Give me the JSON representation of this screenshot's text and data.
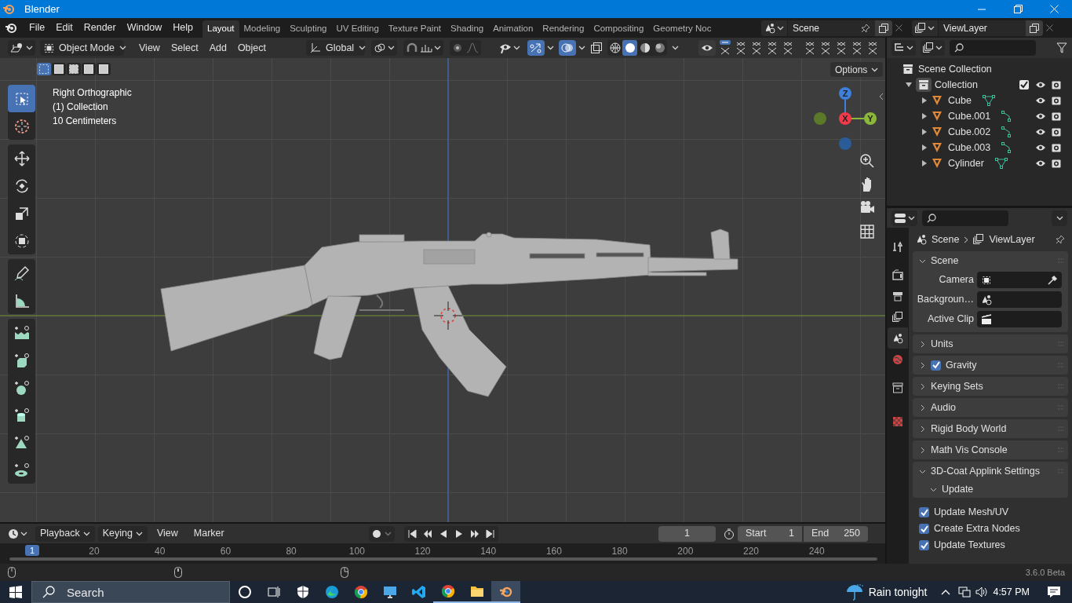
{
  "window": {
    "title": "Blender"
  },
  "menu": [
    "File",
    "Edit",
    "Render",
    "Window",
    "Help"
  ],
  "workspaces": [
    {
      "label": "Layout",
      "selected": true
    },
    {
      "label": "Modeling",
      "selected": false
    },
    {
      "label": "Sculpting",
      "selected": false
    },
    {
      "label": "UV Editing",
      "selected": false
    },
    {
      "label": "Texture Paint",
      "selected": false
    },
    {
      "label": "Shading",
      "selected": false
    },
    {
      "label": "Animation",
      "selected": false
    },
    {
      "label": "Rendering",
      "selected": false
    },
    {
      "label": "Compositing",
      "selected": false
    },
    {
      "label": "Geometry Noc",
      "selected": false
    }
  ],
  "scene_selector": {
    "value": "Scene"
  },
  "view_layer_selector": {
    "value": "ViewLayer"
  },
  "viewport": {
    "mode": "Object Mode",
    "menus": [
      "View",
      "Select",
      "Add",
      "Object"
    ],
    "orientation": "Global",
    "select_modes": [
      {
        "selected": true
      },
      {
        "selected": false
      },
      {
        "selected": false
      },
      {
        "selected": false
      },
      {
        "selected": false
      }
    ],
    "snap_toggle": {
      "on": false
    },
    "proportional_toggle": {
      "on": false
    },
    "gizmo_toggle": {
      "on": true
    },
    "overlay_toggle": {
      "on": true
    },
    "shading": [
      {
        "selected": false
      },
      {
        "selected": true
      },
      {
        "selected": false
      },
      {
        "selected": false
      }
    ],
    "options": "Options",
    "info": [
      "Right Orthographic",
      "(1) Collection",
      "10 Centimeters"
    ],
    "axes": {
      "x": "X",
      "y": "Y",
      "z": "Z"
    },
    "tools": [
      {
        "selected": true
      },
      {
        "selected": false
      },
      {
        "selected": false
      },
      {
        "selected": false
      },
      {
        "selected": false
      },
      {
        "selected": false
      },
      {
        "selected": false
      },
      {
        "selected": false
      },
      {
        "selected": false
      },
      {
        "selected": false
      },
      {
        "selected": false
      },
      {
        "selected": false
      },
      {
        "selected": false
      },
      {
        "selected": false
      }
    ]
  },
  "outliner": {
    "root": "Scene Collection",
    "items": [
      {
        "name": "Collection",
        "expanded": true,
        "checked": true,
        "children": [
          {
            "name": "Cube",
            "kind": "mesh",
            "expanded": false
          },
          {
            "name": "Cube.001",
            "kind": "curve",
            "expanded": false
          },
          {
            "name": "Cube.002",
            "kind": "curve",
            "expanded": false
          },
          {
            "name": "Cube.003",
            "kind": "curve",
            "expanded": false
          },
          {
            "name": "Cylinder",
            "kind": "mesh",
            "expanded": false
          }
        ]
      }
    ]
  },
  "properties": {
    "tabs": [
      {
        "selected": false
      },
      {
        "selected": false
      },
      {
        "selected": false
      },
      {
        "selected": false
      },
      {
        "selected": true
      },
      {
        "selected": false
      },
      {
        "selected": false
      },
      {
        "selected": false
      }
    ],
    "breadcrumb": [
      "Scene",
      "ViewLayer"
    ],
    "panels": [
      {
        "title": "Scene",
        "expanded": true,
        "fields": [
          {
            "label": "Camera"
          },
          {
            "label": "Backgroun…"
          },
          {
            "label": "Active Clip"
          }
        ]
      },
      {
        "title": "Units",
        "expanded": false
      },
      {
        "title": "Gravity",
        "expanded": false,
        "checked": true
      },
      {
        "title": "Keying Sets",
        "expanded": false
      },
      {
        "title": "Audio",
        "expanded": false
      },
      {
        "title": "Rigid Body World",
        "expanded": false
      },
      {
        "title": "Math Vis Console",
        "expanded": false
      },
      {
        "title": "3D-Coat Applink Settings",
        "expanded": true,
        "subpanel": {
          "title": "Update",
          "expanded": true
        },
        "options": [
          {
            "label": "Update Mesh/UV",
            "checked": true
          },
          {
            "label": "Create Extra Nodes",
            "checked": true
          },
          {
            "label": "Update Textures",
            "checked": true
          }
        ]
      }
    ]
  },
  "timeline": {
    "menus": [
      "Playback",
      "Keying",
      "View",
      "Marker"
    ],
    "current_frame": "1",
    "start": {
      "label": "Start",
      "value": "1"
    },
    "end": {
      "label": "End",
      "value": "250"
    },
    "playhead": "1",
    "ruler": [
      "20",
      "40",
      "60",
      "80",
      "100",
      "120",
      "140",
      "160",
      "180",
      "200",
      "220",
      "240"
    ]
  },
  "status_bar": {
    "version": "3.6.0 Beta"
  },
  "taskbar": {
    "search": {
      "placeholder": "Search"
    },
    "apps": [
      {
        "selected": false,
        "running": false
      },
      {
        "selected": false,
        "running": false
      },
      {
        "selected": false,
        "running": false
      },
      {
        "selected": false,
        "running": false
      },
      {
        "selected": false,
        "running": false
      },
      {
        "selected": false,
        "running": false
      },
      {
        "selected": false,
        "running": false
      },
      {
        "selected": false,
        "running": true
      },
      {
        "selected": false,
        "running": true
      },
      {
        "selected": true,
        "running": true
      }
    ],
    "weather": "Rain tonight",
    "time": "4:57 PM"
  }
}
